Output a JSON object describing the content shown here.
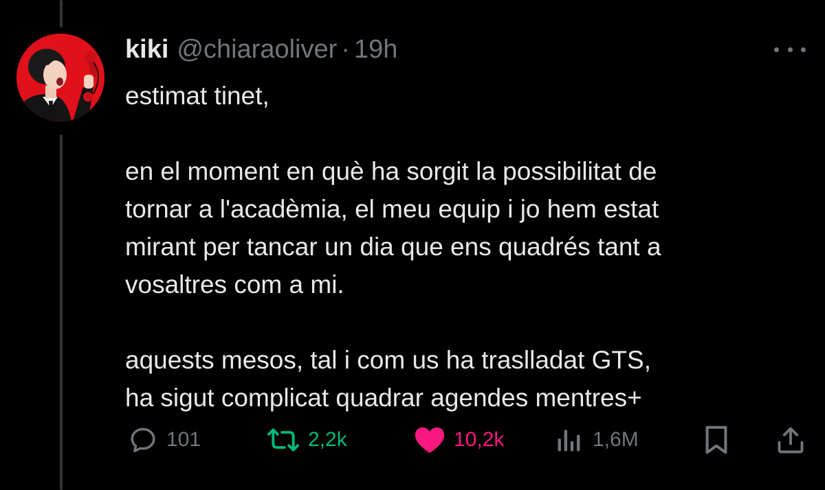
{
  "tweet": {
    "display_name": "kiki",
    "handle": "@chiaraoliver",
    "separator": "·",
    "time": "19h",
    "paragraphs": [
      "estimat tinet,",
      "en el moment en què ha sorgit la possibilitat de\ntornar a l'acadèmia, el meu equip i jo hem estat\nmirant per tancar un dia que ens quadrés tant a\nvosaltres com a mi.",
      "aquests mesos, tal i com us ha traslladat GTS,\nha sigut complicat quadrar agendes mentres+"
    ]
  },
  "actions": {
    "reply": {
      "icon": "reply-icon",
      "count": "101"
    },
    "retweet": {
      "icon": "retweet-icon",
      "count": "2,2k",
      "color": "#00ba7c"
    },
    "like": {
      "icon": "heart-icon",
      "count": "10,2k",
      "color": "#f91880"
    },
    "views": {
      "icon": "views-icon",
      "count": "1,6M"
    },
    "bookmark": {
      "icon": "bookmark-icon"
    },
    "share": {
      "icon": "share-icon"
    }
  },
  "colors": {
    "background": "#000000",
    "text": "#e7e9ea",
    "muted": "#71767b",
    "avatar_background": "#e0111b"
  }
}
